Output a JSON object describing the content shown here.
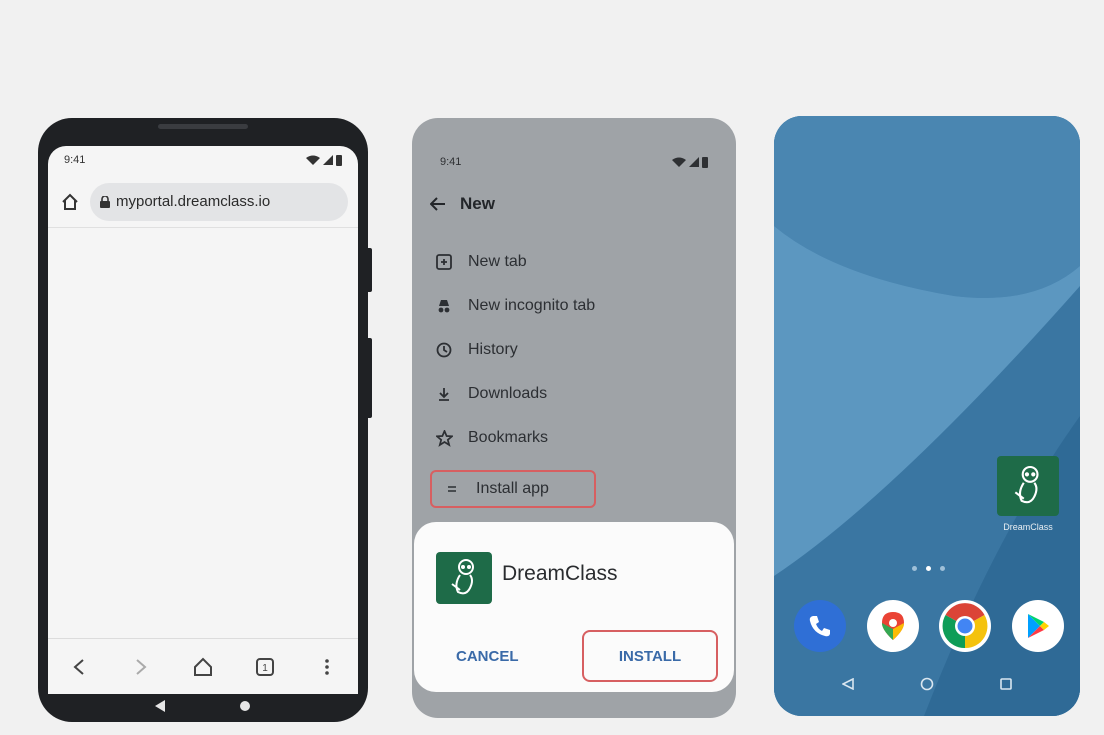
{
  "browser": {
    "time": "9:41",
    "url": "myportal.dreamclass.io",
    "icons": [
      "home-icon",
      "lock-icon",
      "back-icon",
      "forward-icon",
      "home-icon",
      "tabs-icon",
      "more-icon"
    ],
    "tabs_count": "1"
  },
  "menu": {
    "time": "9:41",
    "header": "New",
    "items": [
      {
        "label": "New tab",
        "icon": "new-tab-icon"
      },
      {
        "label": "New incognito tab",
        "icon": "incognito-icon"
      },
      {
        "label": "History",
        "icon": "history-icon"
      },
      {
        "label": "Downloads",
        "icon": "download-icon"
      },
      {
        "label": "Bookmarks",
        "icon": "star-icon"
      },
      {
        "label": "Install app",
        "icon": "install-icon"
      }
    ],
    "highlight_color": "#d75f61"
  },
  "install_dialog": {
    "app_name": "DreamClass",
    "cancel_label": "CANCEL",
    "install_label": "INSTALL",
    "brand_color": "#1e6b48"
  },
  "home": {
    "app_label": "DreamClass",
    "page_count": 3,
    "active_page": 2,
    "dock": [
      "phone-icon",
      "maps-icon",
      "chrome-icon",
      "play-store-icon"
    ]
  }
}
